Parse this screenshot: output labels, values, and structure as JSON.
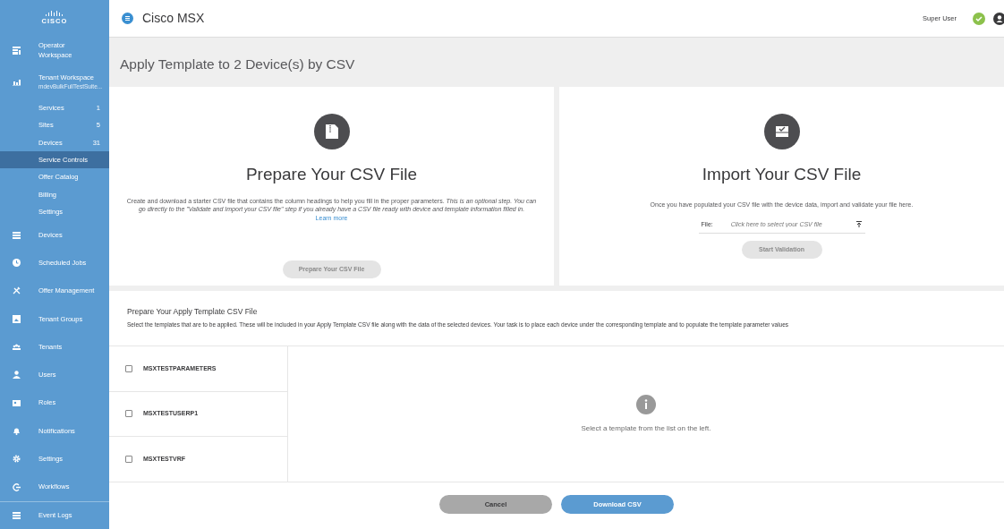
{
  "app": {
    "title": "Cisco MSX",
    "user": "Super User",
    "logo": "CISCO"
  },
  "sidebar": {
    "items": [
      {
        "kind": "main",
        "label": "Operator Workspace",
        "selected": false
      },
      {
        "kind": "main",
        "label": "Tenant Workspace",
        "subtitle": "mdevBulkFullTestSuite...",
        "selected": false
      },
      {
        "kind": "sub",
        "label": "Services",
        "count": "1",
        "selected": false
      },
      {
        "kind": "sub",
        "label": "Sites",
        "count": "5",
        "selected": false
      },
      {
        "kind": "sub",
        "label": "Devices",
        "count": "31",
        "selected": false
      },
      {
        "kind": "sub",
        "label": "Service Controls",
        "selected": true
      },
      {
        "kind": "sub",
        "label": "Offer Catalog",
        "selected": false
      },
      {
        "kind": "sub",
        "label": "Billing",
        "selected": false
      },
      {
        "kind": "sub",
        "label": "Settings",
        "selected": false
      },
      {
        "kind": "main",
        "label": "Devices",
        "selected": false
      },
      {
        "kind": "main",
        "label": "Scheduled Jobs",
        "selected": false
      },
      {
        "kind": "main",
        "label": "Offer Management",
        "selected": false
      },
      {
        "kind": "main",
        "label": "Tenant Groups",
        "selected": false
      },
      {
        "kind": "main",
        "label": "Tenants",
        "selected": false
      },
      {
        "kind": "main",
        "label": "Users",
        "selected": false
      },
      {
        "kind": "main",
        "label": "Roles",
        "selected": false
      },
      {
        "kind": "main",
        "label": "Notifications",
        "selected": false
      },
      {
        "kind": "main",
        "label": "Settings",
        "selected": false
      },
      {
        "kind": "main",
        "label": "Workflows",
        "selected": false
      },
      {
        "kind": "main",
        "label": "Event Logs",
        "selected": false
      }
    ]
  },
  "page_title": "Apply Template to 2 Device(s) by CSV",
  "prepare": {
    "title": "Prepare Your CSV File",
    "description": "Create and download a starter CSV file that contains the column headings to help you fill in the proper parameters. *This is an optional step. You can go directly to the \"Validate and Import your CSV file\" step if you already have a CSV file ready with device and template information filled in.*",
    "link": "Learn more",
    "button": "Prepare Your CSV File",
    "button_disabled": true
  },
  "import": {
    "title": "Import Your CSV File",
    "description": "Once you have populated your CSV file with the device data, import and validate your file here.",
    "file_label": "File:",
    "file_placeholder": "Click here to select your CSV file",
    "button": "Start Validation",
    "button_disabled": true
  },
  "templates": {
    "title": "Prepare Your Apply Template CSV File",
    "description": "Select the templates that are to be applied. These will be included in your Apply Template CSV file along with the data of the selected devices. Your task is to place each device under the corresponding template and to populate the template parameter values",
    "items": [
      {
        "name": "MSXTESTPARAMETERS",
        "checked": false
      },
      {
        "name": "MSXTESTUSERP1",
        "checked": false
      },
      {
        "name": "MSXTESTVRF",
        "checked": false
      }
    ],
    "empty_message": "Select a template from the list on the left."
  },
  "buttons": [
    {
      "kind": "secondary",
      "label": "Cancel"
    },
    {
      "kind": "primary",
      "label": "Download CSV"
    }
  ]
}
